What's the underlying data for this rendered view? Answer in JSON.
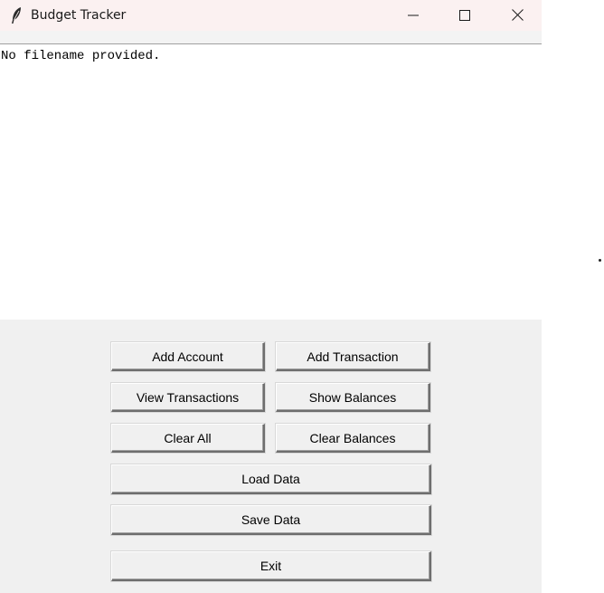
{
  "window": {
    "title": "Budget Tracker",
    "icon": "feather-icon"
  },
  "controls": {
    "minimize": "minimize-icon",
    "maximize": "maximize-icon",
    "close": "close-icon"
  },
  "output": {
    "text": "No filename provided."
  },
  "buttons": {
    "add_account": "Add Account",
    "add_transaction": "Add Transaction",
    "view_transactions": "View Transactions",
    "show_balances": "Show Balances",
    "clear_all": "Clear All",
    "clear_balances": "Clear Balances",
    "load_data": "Load Data",
    "save_data": "Save Data",
    "exit": "Exit"
  }
}
